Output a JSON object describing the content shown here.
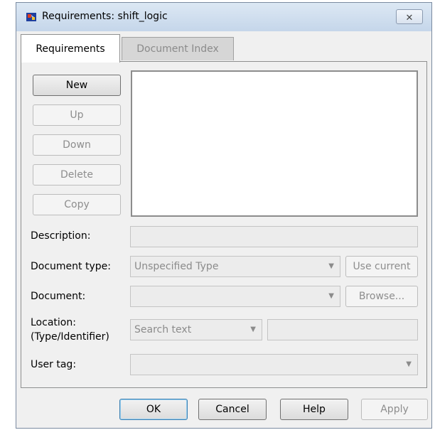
{
  "window": {
    "title": "Requirements: shift_logic",
    "close_symbol": "✕"
  },
  "tabs": [
    {
      "label": "Requirements",
      "active": true
    },
    {
      "label": "Document Index",
      "active": false
    }
  ],
  "side_buttons": {
    "new": "New",
    "up": "Up",
    "down": "Down",
    "delete": "Delete",
    "copy": "Copy"
  },
  "form": {
    "description_label": "Description:",
    "document_type_label": "Document type:",
    "document_type_value": "Unspecified Type",
    "use_current_label": "Use current",
    "document_label": "Document:",
    "document_value": "",
    "browse_label": "Browse...",
    "location_label_line1": "Location:",
    "location_label_line2": "(Type/Identifier)",
    "location_type_value": "Search text",
    "location_identifier_value": "",
    "user_tag_label": "User tag:",
    "user_tag_value": ""
  },
  "dialog_buttons": {
    "ok": "OK",
    "cancel": "Cancel",
    "help": "Help",
    "apply": "Apply"
  },
  "icons": {
    "app": "simulink-model-icon",
    "dropdown": "chevron-down-icon"
  }
}
